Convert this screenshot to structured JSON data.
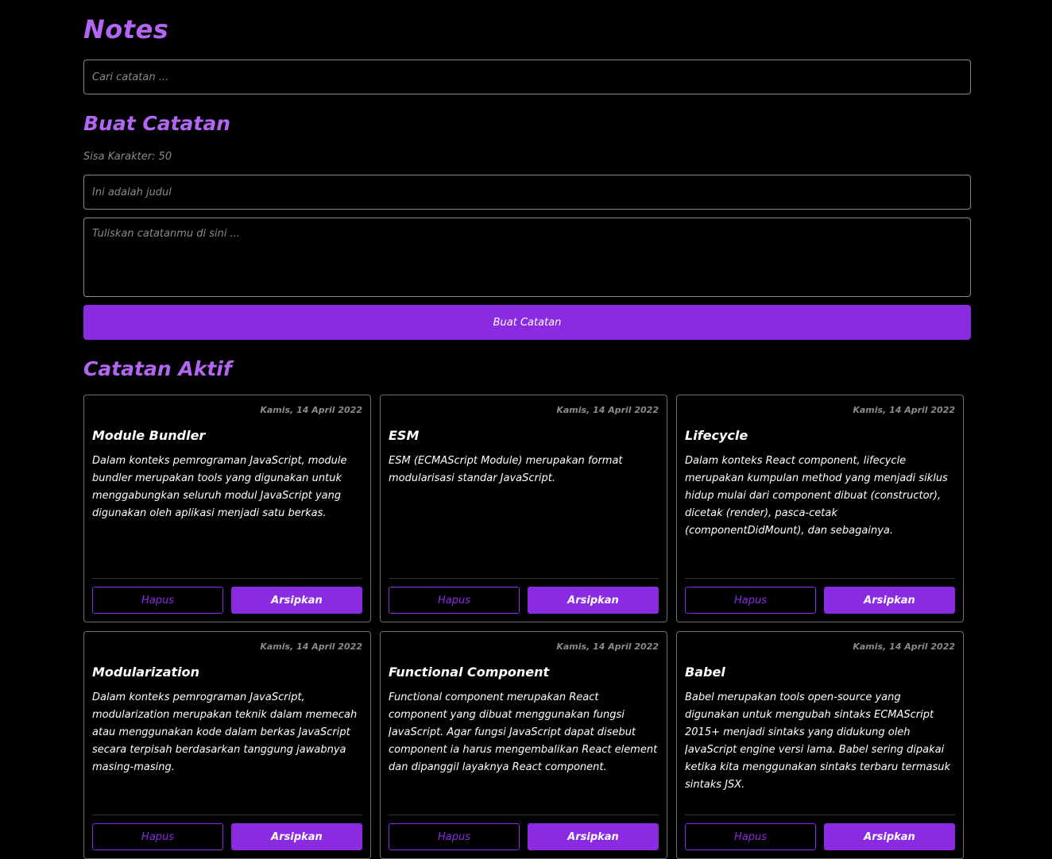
{
  "header": {
    "title": "Notes"
  },
  "search": {
    "placeholder": "Cari catatan ..."
  },
  "create": {
    "heading": "Buat Catatan",
    "chars_left": "Sisa Karakter: 50",
    "title_placeholder": "Ini adalah judul",
    "body_placeholder": "Tuliskan catatanmu di sini ...",
    "submit_label": "Buat Catatan"
  },
  "active": {
    "heading": "Catatan Aktif",
    "delete_label": "Hapus",
    "archive_label": "Arsipkan",
    "notes": [
      {
        "date": "Kamis, 14 April 2022",
        "title": "Module Bundler",
        "body": "Dalam konteks pemrograman JavaScript, module bundler merupakan tools yang digunakan untuk menggabungkan seluruh modul JavaScript yang digunakan oleh aplikasi menjadi satu berkas."
      },
      {
        "date": "Kamis, 14 April 2022",
        "title": "ESM",
        "body": "ESM (ECMAScript Module) merupakan format modularisasi standar JavaScript."
      },
      {
        "date": "Kamis, 14 April 2022",
        "title": "Lifecycle",
        "body": "Dalam konteks React component, lifecycle merupakan kumpulan method yang menjadi siklus hidup mulai dari component dibuat (constructor), dicetak (render), pasca-cetak (componentDidMount), dan sebagainya."
      },
      {
        "date": "Kamis, 14 April 2022",
        "title": "Modularization",
        "body": "Dalam konteks pemrograman JavaScript, modularization merupakan teknik dalam memecah atau menggunakan kode dalam berkas JavaScript secara terpisah berdasarkan tanggung jawabnya masing-masing."
      },
      {
        "date": "Kamis, 14 April 2022",
        "title": "Functional Component",
        "body": "Functional component merupakan React component yang dibuat menggunakan fungsi JavaScript. Agar fungsi JavaScript dapat disebut component ia harus mengembalikan React element dan dipanggil layaknya React component."
      },
      {
        "date": "Kamis, 14 April 2022",
        "title": "Babel",
        "body": "Babel merupakan tools open-source yang digunakan untuk mengubah sintaks ECMAScript 2015+ menjadi sintaks yang didukung oleh JavaScript engine versi lama. Babel sering dipakai ketika kita menggunakan sintaks terbaru termasuk sintaks JSX."
      }
    ]
  }
}
